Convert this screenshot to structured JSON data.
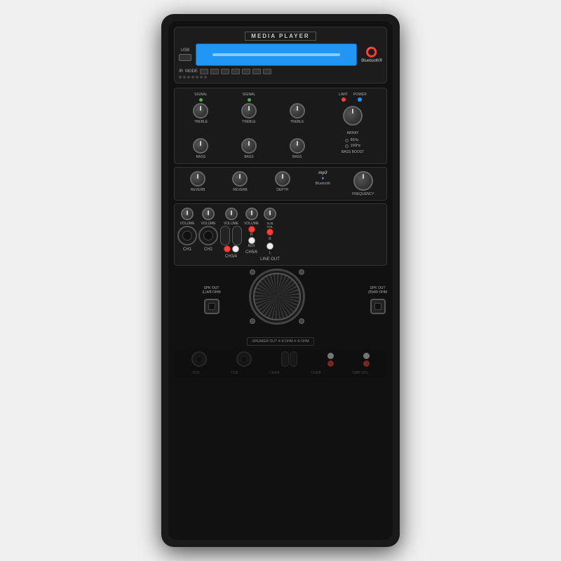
{
  "device": {
    "title": "MEDIA PLAYER",
    "bluetooth_text": "Bluetooth®",
    "usb_label": "USB",
    "ir_label": "IR",
    "mode_label": "MODE",
    "limit_label": "LIMIT",
    "power_label": "POWER",
    "array_label": "ARRAY",
    "bass_boost_label": "BASS BOOST",
    "freq_80": "80Hz",
    "freq_100": "100Hz",
    "mp3_label": "mp3",
    "bt_label": "Bluetooth",
    "channel_labels": [
      "CH1",
      "CH2",
      "CH3/4",
      "CH5/6",
      "LINE OUT"
    ],
    "spk_out_left": "SPK OUT\n(L)4/8 OHM",
    "spk_out_right": "SPK OUT\n(R)4/8 OHM",
    "speaker_out_note": "SPEAKER OUT\n4~8 OHM\n4~6 OHM",
    "reverb_label": "REVERB",
    "depth_label": "DEPTH",
    "frequency_label": "FREQUENCY",
    "volume_label": "VOLUME",
    "sub_volume_label": "SUB\nVOLUME",
    "treble_labels": [
      "TREBLE",
      "TREBLE",
      "TREBLE"
    ],
    "bass_labels": [
      "BASS",
      "BASS",
      "BASS"
    ],
    "signal_labels": [
      "SIGNAL",
      "SIGNAL"
    ],
    "aux_label": "AUX",
    "r_label": "R",
    "l_label": "L"
  }
}
